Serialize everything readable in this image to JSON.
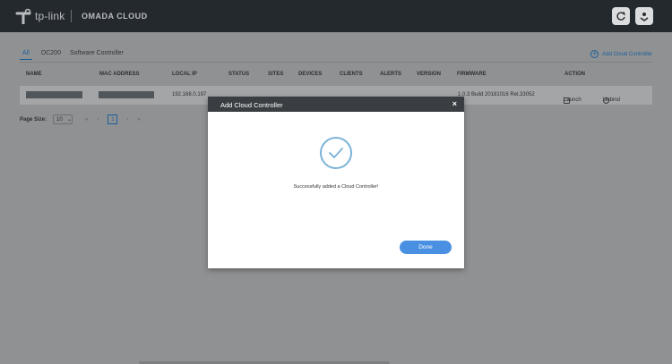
{
  "app": {
    "logo_text": "tp-link",
    "title": "OMADA CLOUD"
  },
  "tabs": [
    {
      "label": "All",
      "active": true
    },
    {
      "label": "OC200",
      "active": false
    },
    {
      "label": "Software Controller",
      "active": false
    }
  ],
  "add_controller_label": "Add Cloud Controller",
  "table": {
    "headers": [
      "NAME",
      "MAC ADDRESS",
      "LOCAL IP",
      "STATUS",
      "SITES",
      "DEVICES",
      "CLIENTS",
      "ALERTS",
      "VERSION",
      "FIRMWARE",
      "ACTION"
    ],
    "rows": [
      {
        "local_ip": "192.168.0.197",
        "firmware": "1.0.3 Build 20181016 Rel.33052",
        "actions": [
          "Launch",
          "Unbind"
        ]
      }
    ]
  },
  "pager": {
    "label": "Page Size:",
    "size": "10",
    "first": "«",
    "prev": "‹",
    "page": "1",
    "next": "›",
    "last": "»"
  },
  "modal": {
    "title": "Add Cloud Controller",
    "close": "×",
    "message": "Successfully added a Cloud Controller!",
    "done_label": "Done"
  },
  "colors": {
    "topbar": "#24292e",
    "accent": "#1d5f9a",
    "button": "#4a90e2",
    "check": "#7bb3d9"
  }
}
